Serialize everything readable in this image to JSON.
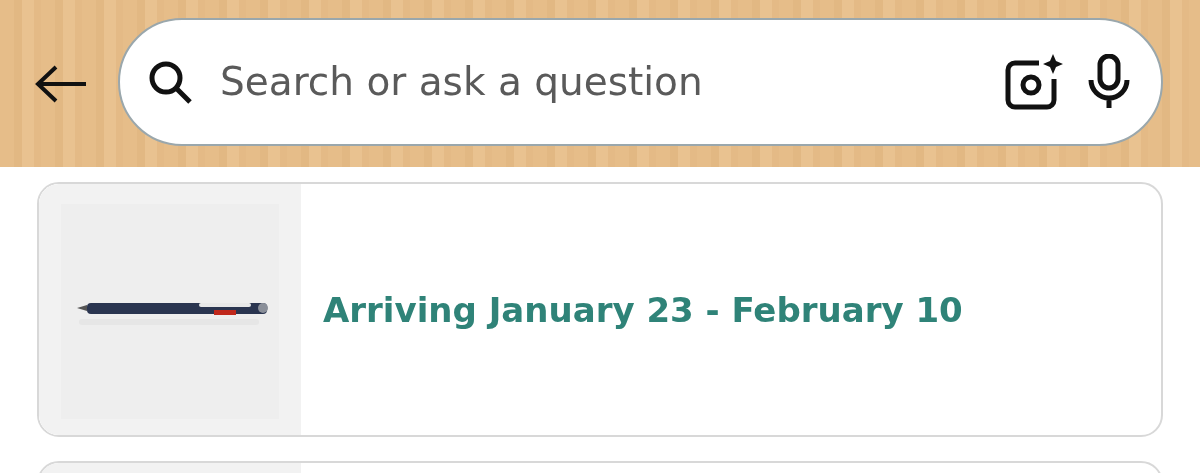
{
  "search": {
    "placeholder": "Search or ask a question"
  },
  "orders": [
    {
      "status": "Arriving January 23 - February 10"
    },
    {
      "image": {
        "kind": "cut-off"
      }
    }
  ]
}
